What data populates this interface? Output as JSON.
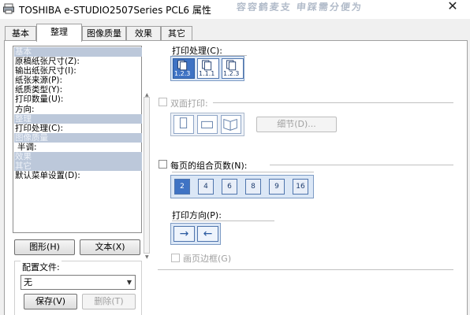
{
  "window": {
    "title": "TOSHIBA e-STUDIO2507Series PCL6 属性",
    "blurred_title": "容容鹤麦支  申踩需分便为"
  },
  "tabs": [
    {
      "label": "基本",
      "active": false
    },
    {
      "label": "整理",
      "active": true
    },
    {
      "label": "图像质量",
      "active": false
    },
    {
      "label": "效果",
      "active": false
    },
    {
      "label": "其它",
      "active": false
    }
  ],
  "settings_list": [
    {
      "label": "基本",
      "category": true
    },
    {
      "label": "原稿纸张尺寸(Z):",
      "category": false
    },
    {
      "label": "输出纸张尺寸(I):",
      "category": false
    },
    {
      "label": "纸张来源(P):",
      "category": false
    },
    {
      "label": "纸质类型(Y):",
      "category": false
    },
    {
      "label": "打印数量(U):",
      "category": false
    },
    {
      "label": "方向:",
      "category": false
    },
    {
      "label": "整理",
      "category": true
    },
    {
      "label": "打印处理(C):",
      "category": false
    },
    {
      "label": "图像质量",
      "category": true
    },
    {
      "label": "半调:",
      "category": false
    },
    {
      "label": "效果",
      "category": true
    },
    {
      "label": "其它",
      "category": true
    },
    {
      "label": "默认菜单设置(D):",
      "category": false
    }
  ],
  "left_buttons": {
    "graphic": "图形(H)",
    "text": "文本(X)"
  },
  "profile": {
    "group_label": "配置文件:",
    "selected": "无",
    "save": "保存(V)",
    "delete": "删除(T)"
  },
  "print_process": {
    "label": "打印处理(C):",
    "options": [
      "1.2.3",
      "1.1.1",
      "1.2.3"
    ]
  },
  "duplex": {
    "label": "双面打印:",
    "details_button": "细节(D)..."
  },
  "nup": {
    "label": "每页的组合页数(N):",
    "options": [
      "2",
      "4",
      "6",
      "8",
      "9",
      "16"
    ]
  },
  "orientation": {
    "label": "打印方向(P):",
    "arrows": [
      "→",
      "←"
    ]
  },
  "border": {
    "label": "画页边框(G)"
  },
  "colors": {
    "accent": "#3f73c4",
    "selection": "#bcc8da"
  }
}
